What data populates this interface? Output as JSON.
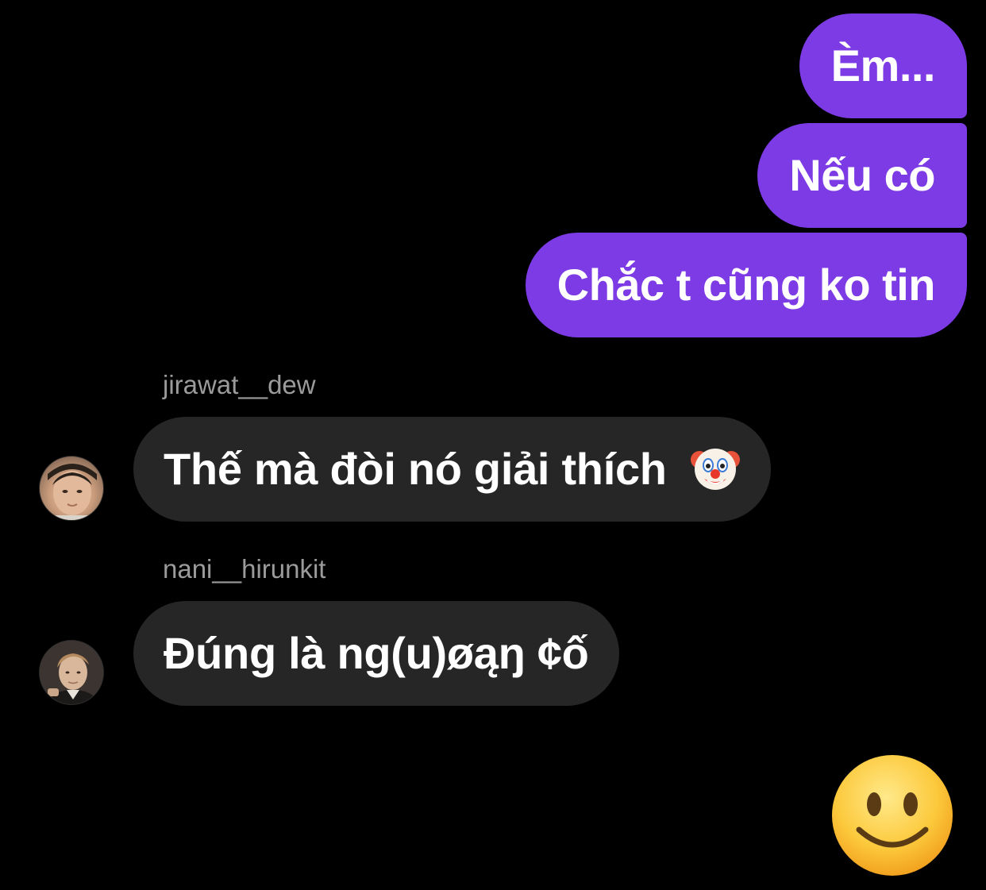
{
  "outgoing_messages": [
    {
      "text": "Èm..."
    },
    {
      "text": "Nếu có"
    },
    {
      "text": "Chắc t cũng ko tin"
    }
  ],
  "incoming_messages": [
    {
      "sender": "jirawat__dew",
      "text": "Thế mà đòi nó giải thích",
      "emoji": "clown-face"
    },
    {
      "sender": "nani__hirunkit",
      "text": "Đúng là ng(u)øąŋ ¢ố"
    }
  ],
  "composer": {
    "quick_reaction": "slightly-smiling-face"
  },
  "colors": {
    "background": "#000000",
    "outgoing_bubble": "#7d3be6",
    "incoming_bubble": "#262626",
    "sender_name": "#9b9b9b"
  }
}
